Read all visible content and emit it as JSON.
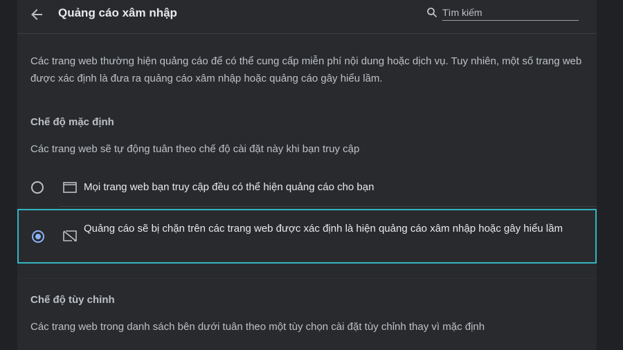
{
  "header": {
    "title": "Quảng cáo xâm nhập",
    "search_placeholder": "Tìm kiếm"
  },
  "description": "Các trang web thường hiện quảng cáo để có thể cung cấp miễn phí nội dung hoặc dịch vụ. Tuy nhiên, một số trang web được xác định là đưa ra quảng cáo xâm nhập hoặc quảng cáo gây hiểu lầm.",
  "default_mode": {
    "title": "Chế độ mặc định",
    "description": "Các trang web sẽ tự động tuân theo chế độ cài đặt này khi bạn truy cập",
    "options": [
      {
        "label": "Mọi trang web bạn truy cập đều có thể hiện quảng cáo cho bạn",
        "icon": "window-icon",
        "selected": false
      },
      {
        "label": "Quảng cáo sẽ bị chặn trên các trang web được xác định là hiện quảng cáo xâm nhập hoặc gây hiểu lầm",
        "icon": "ads-blocked-icon",
        "selected": true
      }
    ]
  },
  "custom_mode": {
    "title": "Chế độ tùy chỉnh",
    "description": "Các trang web trong danh sách bên dưới tuân theo một tùy chọn cài đặt tùy chỉnh thay vì mặc định"
  },
  "colors": {
    "page_bg": "#202124",
    "card_bg": "#292a2d",
    "focus_ring": "#33b5c1",
    "radio_selected": "#8ab4f8"
  }
}
